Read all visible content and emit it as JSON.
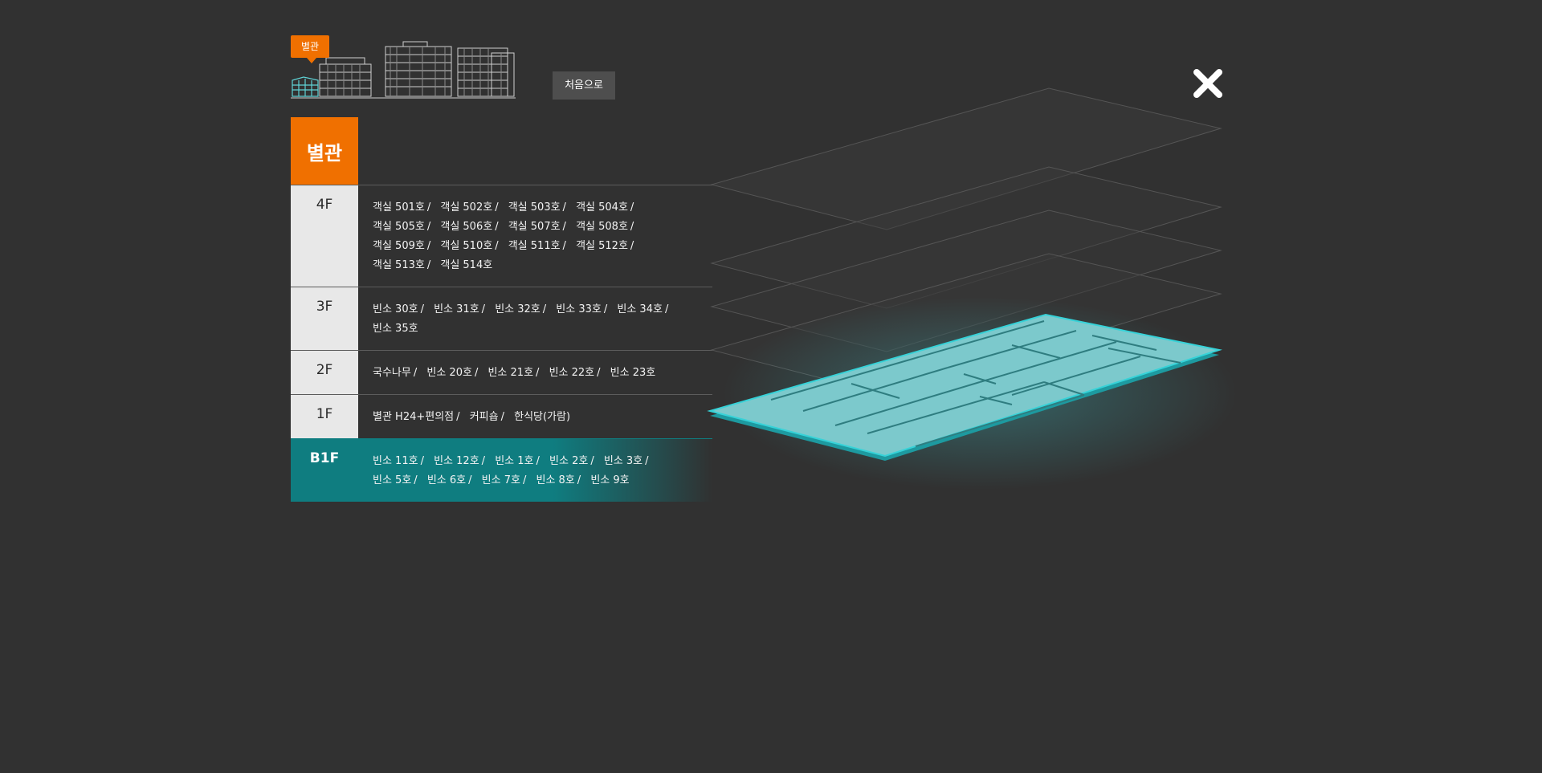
{
  "header": {
    "building_badge": "별관",
    "home_button": "처음으로"
  },
  "building": {
    "name": "별관"
  },
  "floors": [
    {
      "label": "4F",
      "active": false,
      "rooms": [
        "객실 501호",
        "객실 502호",
        "객실 503호",
        "객실 504호",
        "객실 505호",
        "객실 506호",
        "객실 507호",
        "객실 508호",
        "객실 509호",
        "객실 510호",
        "객실 511호",
        "객실 512호",
        "객실 513호",
        "객실 514호"
      ]
    },
    {
      "label": "3F",
      "active": false,
      "rooms": [
        "빈소 30호",
        "빈소 31호",
        "빈소 32호",
        "빈소 33호",
        "빈소 34호",
        "빈소 35호"
      ]
    },
    {
      "label": "2F",
      "active": false,
      "rooms": [
        "국수나무",
        "빈소 20호",
        "빈소 21호",
        "빈소 22호",
        "빈소 23호"
      ]
    },
    {
      "label": "1F",
      "active": false,
      "rooms": [
        "별관 H24+편의점",
        "커피숍",
        "한식당(가람)"
      ]
    },
    {
      "label": "B1F",
      "active": true,
      "rooms": [
        "빈소 11호",
        "빈소 12호",
        "빈소 1호",
        "빈소 2호",
        "빈소 3호",
        "빈소 5호",
        "빈소 6호",
        "빈소 7호",
        "빈소 8호",
        "빈소 9호"
      ]
    }
  ],
  "icons": {
    "close": "close-icon",
    "building": "building-illustration-icon"
  },
  "colors": {
    "accent": "#f07000",
    "active_floor": "#0f7d80",
    "active_plan": "#7cc9cc",
    "background": "#313131"
  }
}
